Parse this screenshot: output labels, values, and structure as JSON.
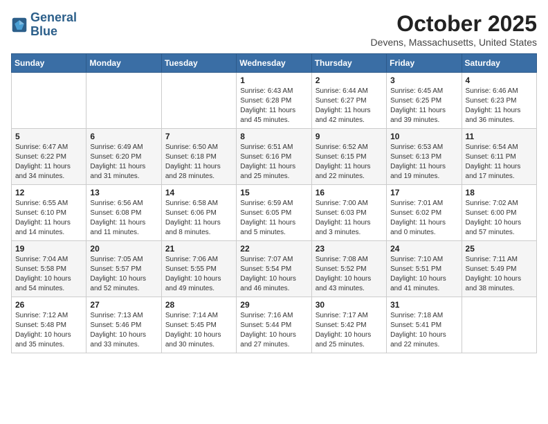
{
  "header": {
    "logo_line1": "General",
    "logo_line2": "Blue",
    "month": "October 2025",
    "location": "Devens, Massachusetts, United States"
  },
  "days_of_week": [
    "Sunday",
    "Monday",
    "Tuesday",
    "Wednesday",
    "Thursday",
    "Friday",
    "Saturday"
  ],
  "weeks": [
    [
      {
        "day": "",
        "content": ""
      },
      {
        "day": "",
        "content": ""
      },
      {
        "day": "",
        "content": ""
      },
      {
        "day": "1",
        "content": "Sunrise: 6:43 AM\nSunset: 6:28 PM\nDaylight: 11 hours\nand 45 minutes."
      },
      {
        "day": "2",
        "content": "Sunrise: 6:44 AM\nSunset: 6:27 PM\nDaylight: 11 hours\nand 42 minutes."
      },
      {
        "day": "3",
        "content": "Sunrise: 6:45 AM\nSunset: 6:25 PM\nDaylight: 11 hours\nand 39 minutes."
      },
      {
        "day": "4",
        "content": "Sunrise: 6:46 AM\nSunset: 6:23 PM\nDaylight: 11 hours\nand 36 minutes."
      }
    ],
    [
      {
        "day": "5",
        "content": "Sunrise: 6:47 AM\nSunset: 6:22 PM\nDaylight: 11 hours\nand 34 minutes."
      },
      {
        "day": "6",
        "content": "Sunrise: 6:49 AM\nSunset: 6:20 PM\nDaylight: 11 hours\nand 31 minutes."
      },
      {
        "day": "7",
        "content": "Sunrise: 6:50 AM\nSunset: 6:18 PM\nDaylight: 11 hours\nand 28 minutes."
      },
      {
        "day": "8",
        "content": "Sunrise: 6:51 AM\nSunset: 6:16 PM\nDaylight: 11 hours\nand 25 minutes."
      },
      {
        "day": "9",
        "content": "Sunrise: 6:52 AM\nSunset: 6:15 PM\nDaylight: 11 hours\nand 22 minutes."
      },
      {
        "day": "10",
        "content": "Sunrise: 6:53 AM\nSunset: 6:13 PM\nDaylight: 11 hours\nand 19 minutes."
      },
      {
        "day": "11",
        "content": "Sunrise: 6:54 AM\nSunset: 6:11 PM\nDaylight: 11 hours\nand 17 minutes."
      }
    ],
    [
      {
        "day": "12",
        "content": "Sunrise: 6:55 AM\nSunset: 6:10 PM\nDaylight: 11 hours\nand 14 minutes."
      },
      {
        "day": "13",
        "content": "Sunrise: 6:56 AM\nSunset: 6:08 PM\nDaylight: 11 hours\nand 11 minutes."
      },
      {
        "day": "14",
        "content": "Sunrise: 6:58 AM\nSunset: 6:06 PM\nDaylight: 11 hours\nand 8 minutes."
      },
      {
        "day": "15",
        "content": "Sunrise: 6:59 AM\nSunset: 6:05 PM\nDaylight: 11 hours\nand 5 minutes."
      },
      {
        "day": "16",
        "content": "Sunrise: 7:00 AM\nSunset: 6:03 PM\nDaylight: 11 hours\nand 3 minutes."
      },
      {
        "day": "17",
        "content": "Sunrise: 7:01 AM\nSunset: 6:02 PM\nDaylight: 11 hours\nand 0 minutes."
      },
      {
        "day": "18",
        "content": "Sunrise: 7:02 AM\nSunset: 6:00 PM\nDaylight: 10 hours\nand 57 minutes."
      }
    ],
    [
      {
        "day": "19",
        "content": "Sunrise: 7:04 AM\nSunset: 5:58 PM\nDaylight: 10 hours\nand 54 minutes."
      },
      {
        "day": "20",
        "content": "Sunrise: 7:05 AM\nSunset: 5:57 PM\nDaylight: 10 hours\nand 52 minutes."
      },
      {
        "day": "21",
        "content": "Sunrise: 7:06 AM\nSunset: 5:55 PM\nDaylight: 10 hours\nand 49 minutes."
      },
      {
        "day": "22",
        "content": "Sunrise: 7:07 AM\nSunset: 5:54 PM\nDaylight: 10 hours\nand 46 minutes."
      },
      {
        "day": "23",
        "content": "Sunrise: 7:08 AM\nSunset: 5:52 PM\nDaylight: 10 hours\nand 43 minutes."
      },
      {
        "day": "24",
        "content": "Sunrise: 7:10 AM\nSunset: 5:51 PM\nDaylight: 10 hours\nand 41 minutes."
      },
      {
        "day": "25",
        "content": "Sunrise: 7:11 AM\nSunset: 5:49 PM\nDaylight: 10 hours\nand 38 minutes."
      }
    ],
    [
      {
        "day": "26",
        "content": "Sunrise: 7:12 AM\nSunset: 5:48 PM\nDaylight: 10 hours\nand 35 minutes."
      },
      {
        "day": "27",
        "content": "Sunrise: 7:13 AM\nSunset: 5:46 PM\nDaylight: 10 hours\nand 33 minutes."
      },
      {
        "day": "28",
        "content": "Sunrise: 7:14 AM\nSunset: 5:45 PM\nDaylight: 10 hours\nand 30 minutes."
      },
      {
        "day": "29",
        "content": "Sunrise: 7:16 AM\nSunset: 5:44 PM\nDaylight: 10 hours\nand 27 minutes."
      },
      {
        "day": "30",
        "content": "Sunrise: 7:17 AM\nSunset: 5:42 PM\nDaylight: 10 hours\nand 25 minutes."
      },
      {
        "day": "31",
        "content": "Sunrise: 7:18 AM\nSunset: 5:41 PM\nDaylight: 10 hours\nand 22 minutes."
      },
      {
        "day": "",
        "content": ""
      }
    ]
  ]
}
